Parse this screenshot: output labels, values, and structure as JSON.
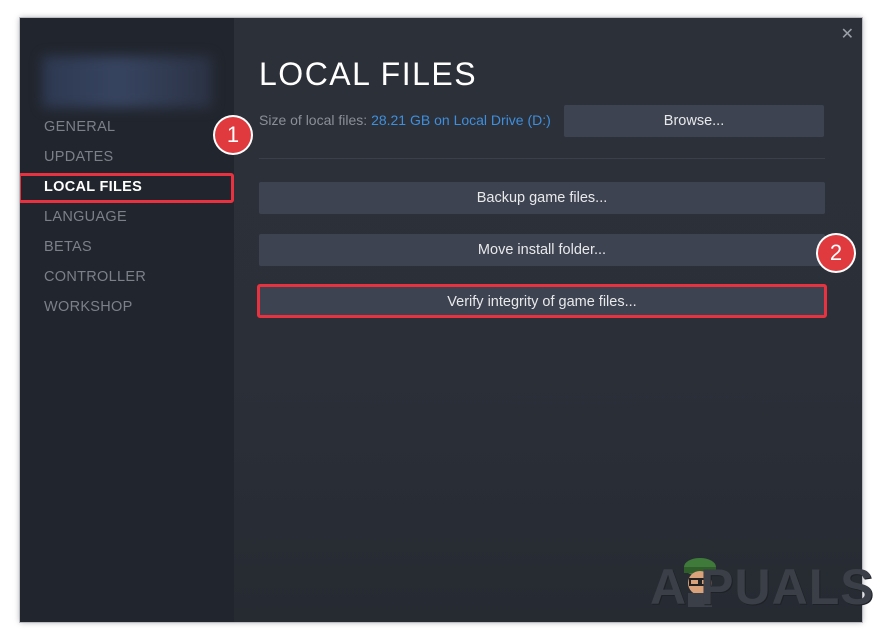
{
  "window": {
    "close_glyph": "✕"
  },
  "sidebar": {
    "items": [
      {
        "label": "GENERAL"
      },
      {
        "label": "UPDATES"
      },
      {
        "label": "LOCAL FILES",
        "active": true
      },
      {
        "label": "LANGUAGE"
      },
      {
        "label": "BETAS"
      },
      {
        "label": "CONTROLLER"
      },
      {
        "label": "WORKSHOP"
      }
    ]
  },
  "main": {
    "title": "LOCAL FILES",
    "size_label": "Size of local files:",
    "size_value": "28.21 GB on Local Drive (D:)",
    "browse_label": "Browse...",
    "backup_label": "Backup game files...",
    "move_label": "Move install folder...",
    "verify_label": "Verify integrity of game files..."
  },
  "annotations": {
    "step1": "1",
    "step2": "2",
    "highlight_color": "#e8323f"
  },
  "watermark": {
    "text": "A  PUALS"
  },
  "colors": {
    "window_bg": "#2a2e36",
    "sidebar_bg": "#21252d",
    "button_bg": "#3d4350",
    "link_blue": "#3f8fdd"
  }
}
